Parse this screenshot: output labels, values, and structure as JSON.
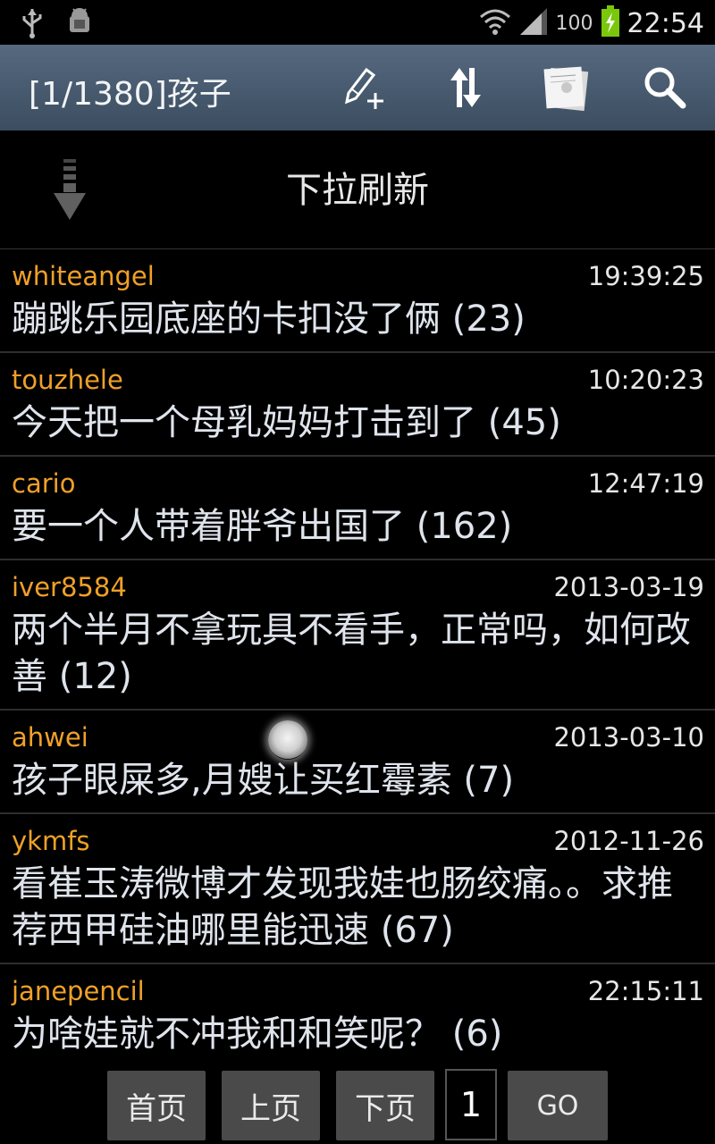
{
  "status_bar": {
    "battery": "100",
    "time": "22:54"
  },
  "action_bar": {
    "title": "[1/1380]孩子"
  },
  "refresh": {
    "label": "下拉刷新"
  },
  "posts": [
    {
      "author": "whiteangel",
      "time": "19:39:25",
      "title": "蹦跳乐园底座的卡扣没了俩 (23)"
    },
    {
      "author": "touzhele",
      "time": "10:20:23",
      "title": "今天把一个母乳妈妈打击到了 (45)"
    },
    {
      "author": "cario",
      "time": "12:47:19",
      "title": "要一个人带着胖爷出国了 (162)"
    },
    {
      "author": "iver8584",
      "time": "2013-03-19",
      "title": "两个半月不拿玩具不看手，正常吗，如何改善 (12)"
    },
    {
      "author": "ahwei",
      "time": "2013-03-10",
      "title": "孩子眼屎多,月嫂让买红霉素 (7)"
    },
    {
      "author": "ykmfs",
      "time": "2012-11-26",
      "title": "看崔玉涛微博才发现我娃也肠绞痛。。求推荐西甲硅油哪里能迅速 (67)"
    },
    {
      "author": "janepencil",
      "time": "22:15:11",
      "title": "为啥娃就不冲我和和笑呢？ (6)"
    }
  ],
  "pager": {
    "first": "首页",
    "prev": "上页",
    "next": "下页",
    "page": "1",
    "go": "GO"
  },
  "colors": {
    "author": "#f0a028",
    "actionbar": "#4a5c70",
    "battery": "#7ac70c"
  }
}
